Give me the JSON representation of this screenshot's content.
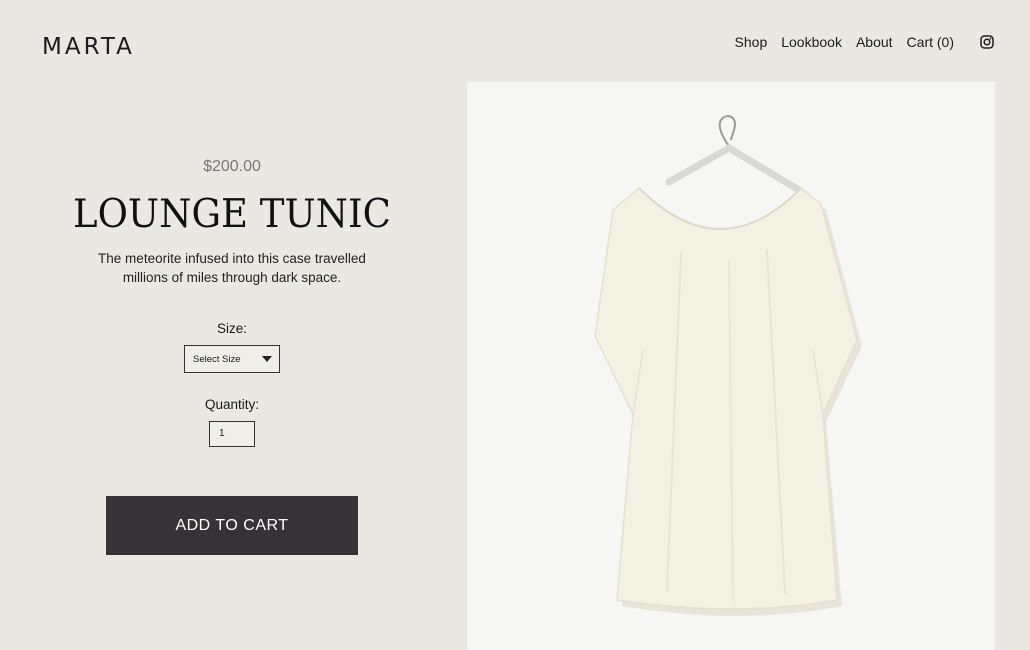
{
  "brand": {
    "logo": "MARTA"
  },
  "nav": {
    "items": [
      "Shop",
      "Lookbook",
      "About",
      "Cart (0)"
    ],
    "icon": "instagram-icon"
  },
  "product": {
    "price": "$200.00",
    "title": "LOUNGE TUNIC",
    "description": "The meteorite infused into this case travelled millions of miles through dark space.",
    "size_label": "Size:",
    "size_value": "Select Size",
    "quantity_label": "Quantity:",
    "quantity_value": "1",
    "add_to_cart_label": "ADD TO CART"
  },
  "colors": {
    "background": "#e9e8e2",
    "button": "#363235",
    "photo_background": "#f6f6f5",
    "garment": "#f3f1e4"
  }
}
